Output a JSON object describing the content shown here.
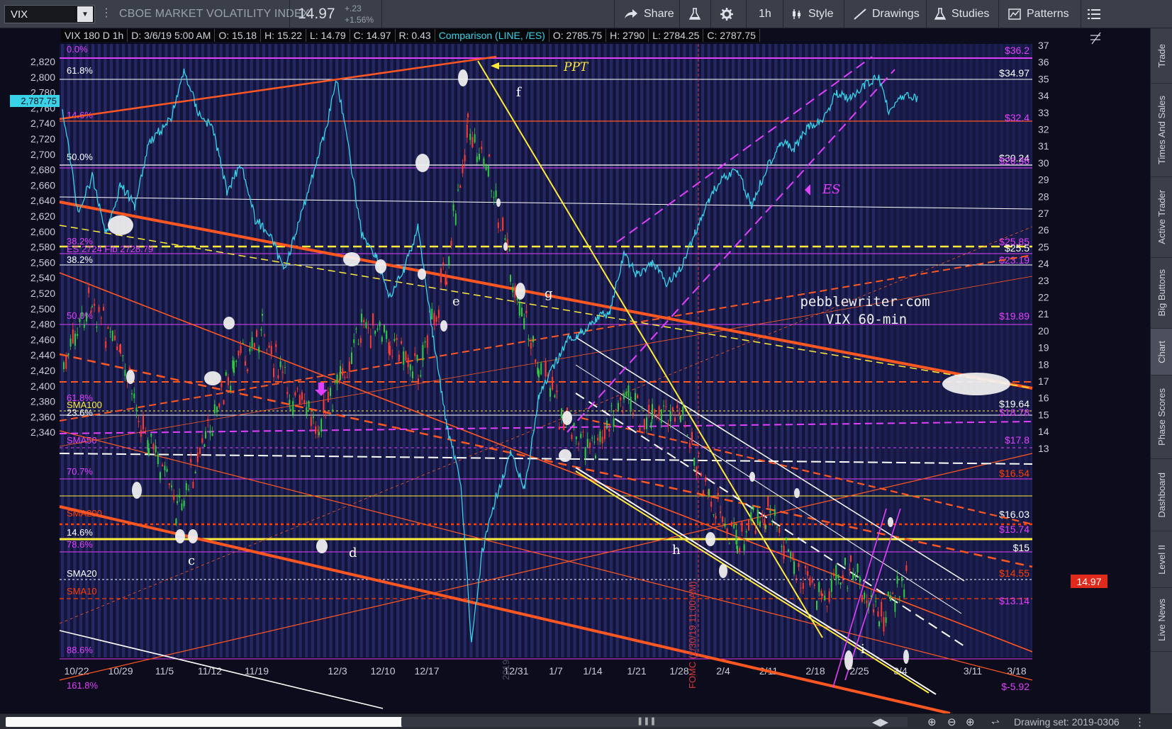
{
  "toolbar": {
    "symbol": "VIX",
    "description": "CBOE MARKET VOLATILITY INDEX",
    "price": "14.97",
    "change": "+.23",
    "change_pct": "+1.56%",
    "share": "Share",
    "timeframe": "1h",
    "style": "Style",
    "drawings": "Drawings",
    "studies": "Studies",
    "patterns": "Patterns"
  },
  "status_line": {
    "title": "VIX 180 D 1h",
    "date": "D: 3/6/19 5:00 AM",
    "open": "O: 15.18",
    "high": "H: 15.22",
    "low": "L: 14.79",
    "close": "C: 14.97",
    "range": "R: 0.43",
    "comparison": "Comparison (LINE, /ES)",
    "cmp_open": "O: 2785.75",
    "cmp_high": "H: 2790",
    "cmp_low": "L: 2784.25",
    "cmp_close": "C: 2787.75"
  },
  "chart": {
    "left_axis_ticks": [
      "2,820",
      "2,800",
      "2,780",
      "2,760",
      "2,740",
      "2,720",
      "2,700",
      "2,680",
      "2,660",
      "2,640",
      "2,620",
      "2,600",
      "2,580",
      "2,560",
      "2,540",
      "2,520",
      "2,500",
      "2,480",
      "2,460",
      "2,440",
      "2,420",
      "2,400",
      "2,380",
      "2,360",
      "2,340"
    ],
    "right_axis_ticks": [
      "37",
      "36",
      "35",
      "34",
      "33",
      "32",
      "31",
      "30",
      "29",
      "28",
      "27",
      "26",
      "25",
      "24",
      "23",
      "22",
      "21",
      "20",
      "19",
      "18",
      "17",
      "16",
      "15",
      "14",
      "13"
    ],
    "x_axis_ticks": [
      "10/22",
      "10/29",
      "11/5",
      "11/12",
      "11/19",
      "12/3",
      "12/10",
      "12/17",
      "12/31",
      "1/7",
      "1/14",
      "1/21",
      "1/28",
      "2/4",
      "2/11",
      "2/18",
      "2/25",
      "3/4",
      "3/11",
      "3/18"
    ],
    "last_es_value": "2,787.75",
    "last_vix_value": "14.97",
    "fib_labels_left": [
      {
        "text": "0.0%",
        "color": "#e040fb"
      },
      {
        "text": "61.8%",
        "color": "#ffffff"
      },
      {
        "text": "14.6%",
        "color": "#e040fb"
      },
      {
        "text": "50.0%",
        "color": "#ffffff"
      },
      {
        "text": "38.2%",
        "color": "#e040fb"
      },
      {
        "text": "ES 2724 Fib 2728.79",
        "color": "#e040fb"
      },
      {
        "text": "38.2%",
        "color": "#ffffff"
      },
      {
        "text": "50.0%",
        "color": "#e040fb"
      },
      {
        "text": "61.8%",
        "color": "#e040fb"
      },
      {
        "text": "SMA100",
        "color": "#ffeb3b"
      },
      {
        "text": "23.6%",
        "color": "#ffffff"
      },
      {
        "text": "SMA50",
        "color": "#e040fb"
      },
      {
        "text": "70.7%",
        "color": "#e040fb"
      },
      {
        "text": "SMA200",
        "color": "#ff3d00"
      },
      {
        "text": "14.6%",
        "color": "#ffffff"
      },
      {
        "text": "78.6%",
        "color": "#e040fb"
      },
      {
        "text": "SMA20",
        "color": "#ffffff"
      },
      {
        "text": "SMA10",
        "color": "#ff3d00"
      },
      {
        "text": "88.6%",
        "color": "#e040fb"
      },
      {
        "text": "161.8%",
        "color": "#e040fb"
      }
    ],
    "level_labels_right": [
      {
        "text": "$36.2",
        "color": "#e040fb"
      },
      {
        "text": "$34.97",
        "color": "#ffffff"
      },
      {
        "text": "$32.4",
        "color": "#e040fb"
      },
      {
        "text": "$30.24",
        "color": "#ffffff"
      },
      {
        "text": "$26.36",
        "color": "#e040fb"
      },
      {
        "text": "$25.85",
        "color": "#e040fb"
      },
      {
        "text": "$25.5",
        "color": "#ffffff"
      },
      {
        "text": "$23.19",
        "color": "#e040fb"
      },
      {
        "text": "$19.89",
        "color": "#e040fb"
      },
      {
        "text": "$19.64",
        "color": "#ffffff"
      },
      {
        "text": "$18.78",
        "color": "#e040fb"
      },
      {
        "text": "$17.8",
        "color": "#e040fb"
      },
      {
        "text": "$16.54",
        "color": "#ff3d00"
      },
      {
        "text": "$16.03",
        "color": "#ffffff"
      },
      {
        "text": "$15.74",
        "color": "#e040fb"
      },
      {
        "text": "$15",
        "color": "#ffffff"
      },
      {
        "text": "$14.55",
        "color": "#ff3d00"
      },
      {
        "text": "$13.14",
        "color": "#e040fb"
      },
      {
        "text": "$-5.92",
        "color": "#e040fb"
      }
    ],
    "letters": [
      "c",
      "d",
      "e",
      "f",
      "g",
      "h",
      "i"
    ],
    "annotations": {
      "ppt": "PPT",
      "es": "ES",
      "watermark_site": "pebblewriter.com",
      "watermark_tf": "VIX 60-min",
      "fomc": "FOMC (1/30/19 11:00 AM)",
      "year": "2019"
    }
  },
  "sidebar": {
    "tabs": [
      "Trade",
      "Times And Sales",
      "Active Trader",
      "Big Buttons",
      "Chart",
      "Phase Scores",
      "Dashboard",
      "Level II",
      "Live News"
    ]
  },
  "bottombar": {
    "drawing_set": "Drawing set: 2019-0306"
  }
}
